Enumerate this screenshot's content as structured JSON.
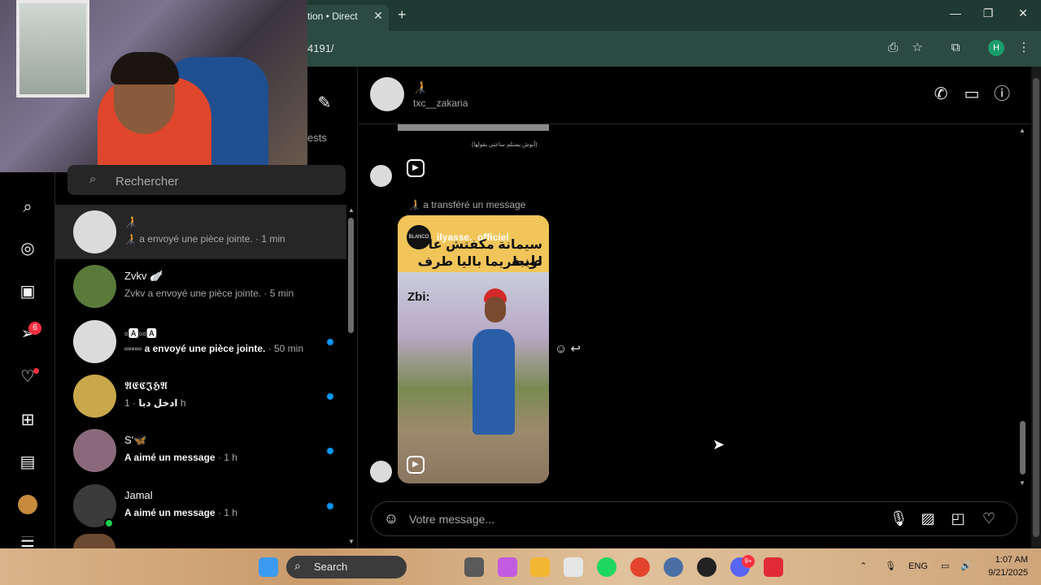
{
  "browser": {
    "tab_title": "tion • Direct",
    "tab_close": "✕",
    "new_tab": "+",
    "url": "4191/",
    "profile_initial": "H",
    "window_controls": [
      "minimize-icon",
      "restore-icon",
      "close-icon"
    ]
  },
  "sidebar": {
    "icons": [
      "search-icon",
      "explore-icon",
      "reels-icon",
      "messages-icon",
      "notifications-icon",
      "create-icon",
      "dashboard-icon",
      "profile-icon",
      "menu-icon"
    ],
    "messages_badge": "6"
  },
  "inbox": {
    "requests_label": "ests",
    "search_placeholder": "Rechercher",
    "conversations": [
      {
        "name": "🧑‍🦯",
        "preview": "🧑‍🦯 a envoyé une pièce jointe.",
        "time": "1 min",
        "unread": false,
        "active": true,
        "avatar_color": "#dbdbdb"
      },
      {
        "name": "Zvkv 🪽",
        "preview": "Zvkv a envoyé une pièce jointe.",
        "time": "5 min",
        "unread": false,
        "active": false,
        "avatar_color": "#5a7a3a"
      },
      {
        "name": "▫🅰▫▫🅰",
        "preview": "▫▫▫▫▫ a envoyé une pièce jointe.",
        "time": "50 min",
        "unread": true,
        "active": false,
        "avatar_color": "#dbdbdb"
      },
      {
        "name": "𝕬𝕰𝕮𝕵𝕳𝕬",
        "preview": "ادخل دبا",
        "time": "1 h",
        "unread": true,
        "active": false,
        "avatar_color": "#c8a84a"
      },
      {
        "name": "S'🦋",
        "preview": "A aimé un message",
        "time": "1 h",
        "unread": true,
        "active": false,
        "avatar_color": "#8a6a7a"
      },
      {
        "name": "Jamal",
        "preview": "A aimé un message",
        "time": "1 h",
        "unread": true,
        "active": false,
        "avatar_color": "#3a3a3a"
      }
    ]
  },
  "chat": {
    "contact_name": "🧑‍🦯",
    "contact_username": "txc__zakaria",
    "small_caption": "(أيوش يستلم ساعتي يقولها)",
    "forwarded_label": "🧑‍🦯 a transféré un message",
    "reel": {
      "account": "ilyasse._officiel",
      "account_logo": "BLANCO",
      "arabic_line1": "سيمانة مكفتش عا طيبة",
      "arabic_line2": "لونطريما باليا طرف دايز",
      "overlay_text": "Zbi:"
    },
    "composer_placeholder": "Votre message..."
  },
  "taskbar": {
    "search_label": "Search",
    "language": "ENG",
    "time": "1:07 AM",
    "date": "9/21/2025",
    "discord_badge": "9+"
  }
}
